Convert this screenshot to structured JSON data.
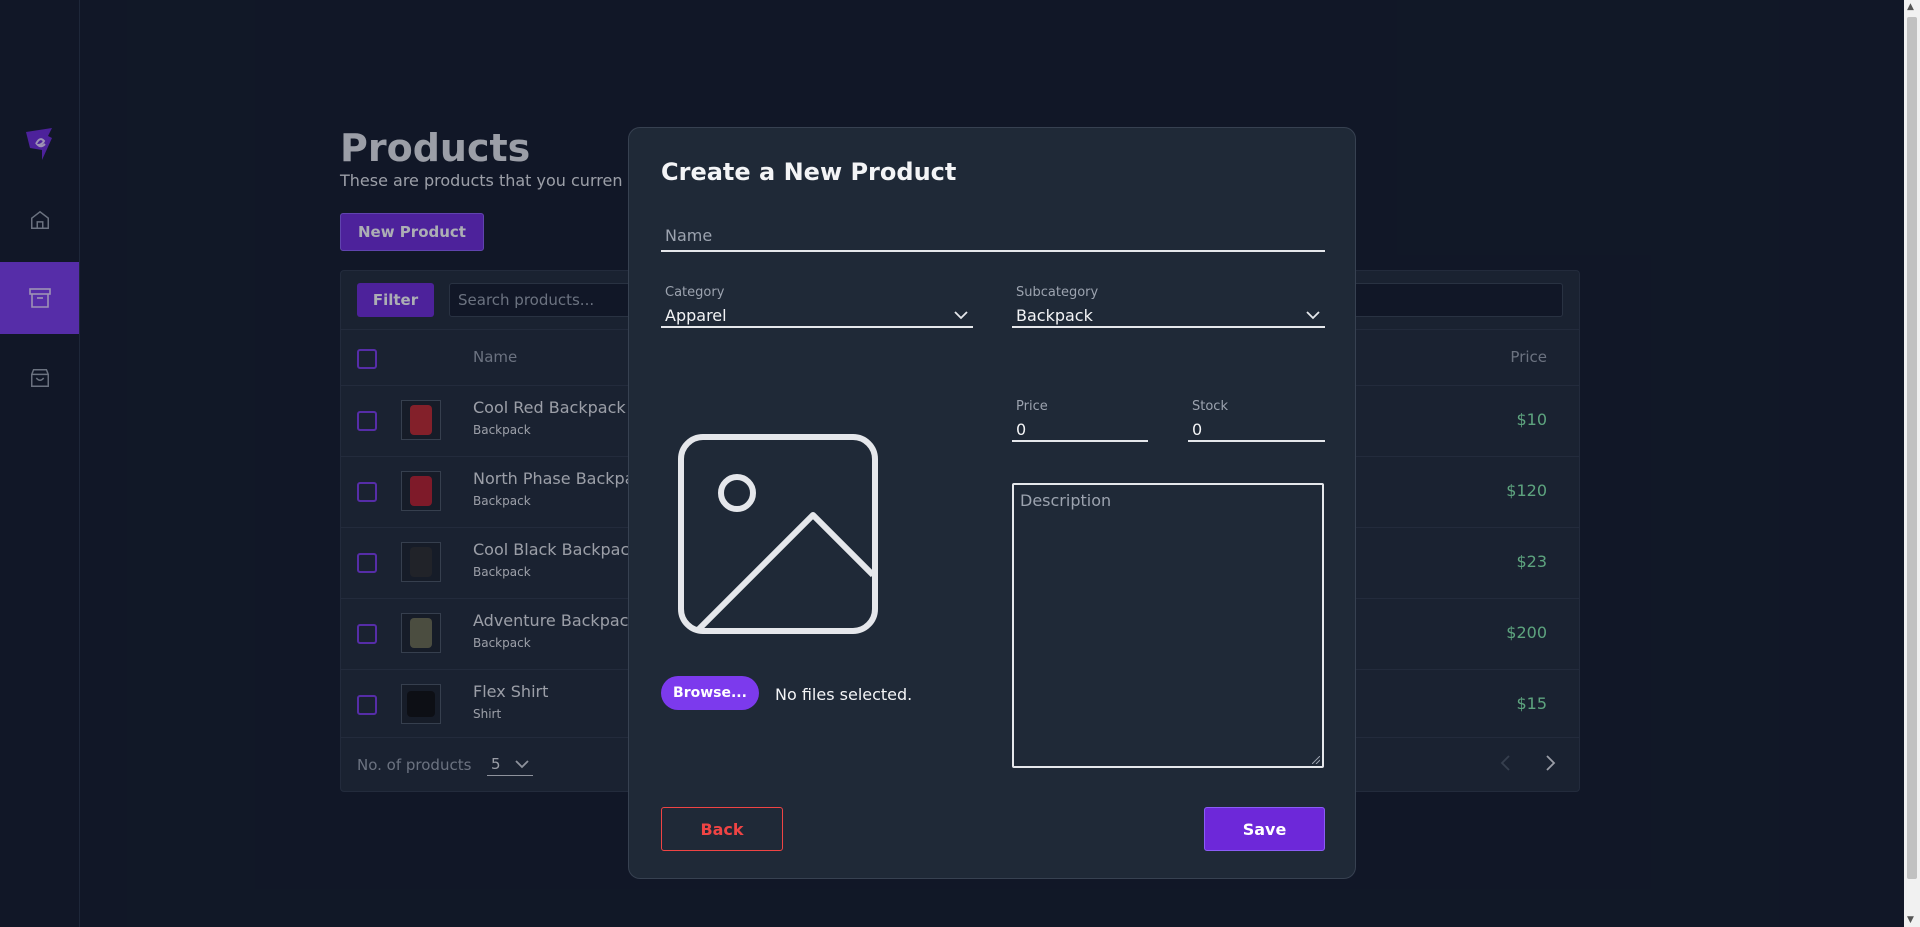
{
  "sidebar": {
    "logo_icon": "brand-logo-icon",
    "items": [
      {
        "name": "home",
        "icon": "home-icon",
        "active": false
      },
      {
        "name": "products",
        "icon": "archive-box-icon",
        "active": true
      },
      {
        "name": "orders",
        "icon": "shopping-bag-icon",
        "active": false
      }
    ]
  },
  "page": {
    "title": "Products",
    "subtitle": "These are products that you curren",
    "new_product_label": "New Product"
  },
  "table": {
    "filter_label": "Filter",
    "search_placeholder": "Search products...",
    "columns": {
      "name": "Name",
      "price": "Price"
    },
    "rows": [
      {
        "name": "Cool Red Backpack",
        "category": "Backpack",
        "price": "$10"
      },
      {
        "name": "North Phase Backpa",
        "category": "Backpack",
        "price": "$120"
      },
      {
        "name": "Cool Black Backpacl",
        "category": "Backpack",
        "price": "$23"
      },
      {
        "name": "Adventure Backpacl",
        "category": "Backpack",
        "price": "$200"
      },
      {
        "name": "Flex Shirt",
        "category": "Shirt",
        "price": "$15"
      }
    ],
    "footer": {
      "count_label": "No. of products",
      "count_value": "5"
    }
  },
  "modal": {
    "title": "Create a New Product",
    "name_placeholder": "Name",
    "category_label": "Category",
    "category_value": "Apparel",
    "subcategory_label": "Subcategory",
    "subcategory_value": "Backpack",
    "price_label": "Price",
    "price_value": "0",
    "stock_label": "Stock",
    "stock_value": "0",
    "description_placeholder": "Description",
    "browse_label": "Browse...",
    "no_files_text": "No files selected.",
    "back_label": "Back",
    "save_label": "Save"
  },
  "colors": {
    "background": "#111827",
    "panel": "#1f2937",
    "accent": "#7c3aed",
    "price_green": "#86efac",
    "danger": "#ef4444"
  }
}
